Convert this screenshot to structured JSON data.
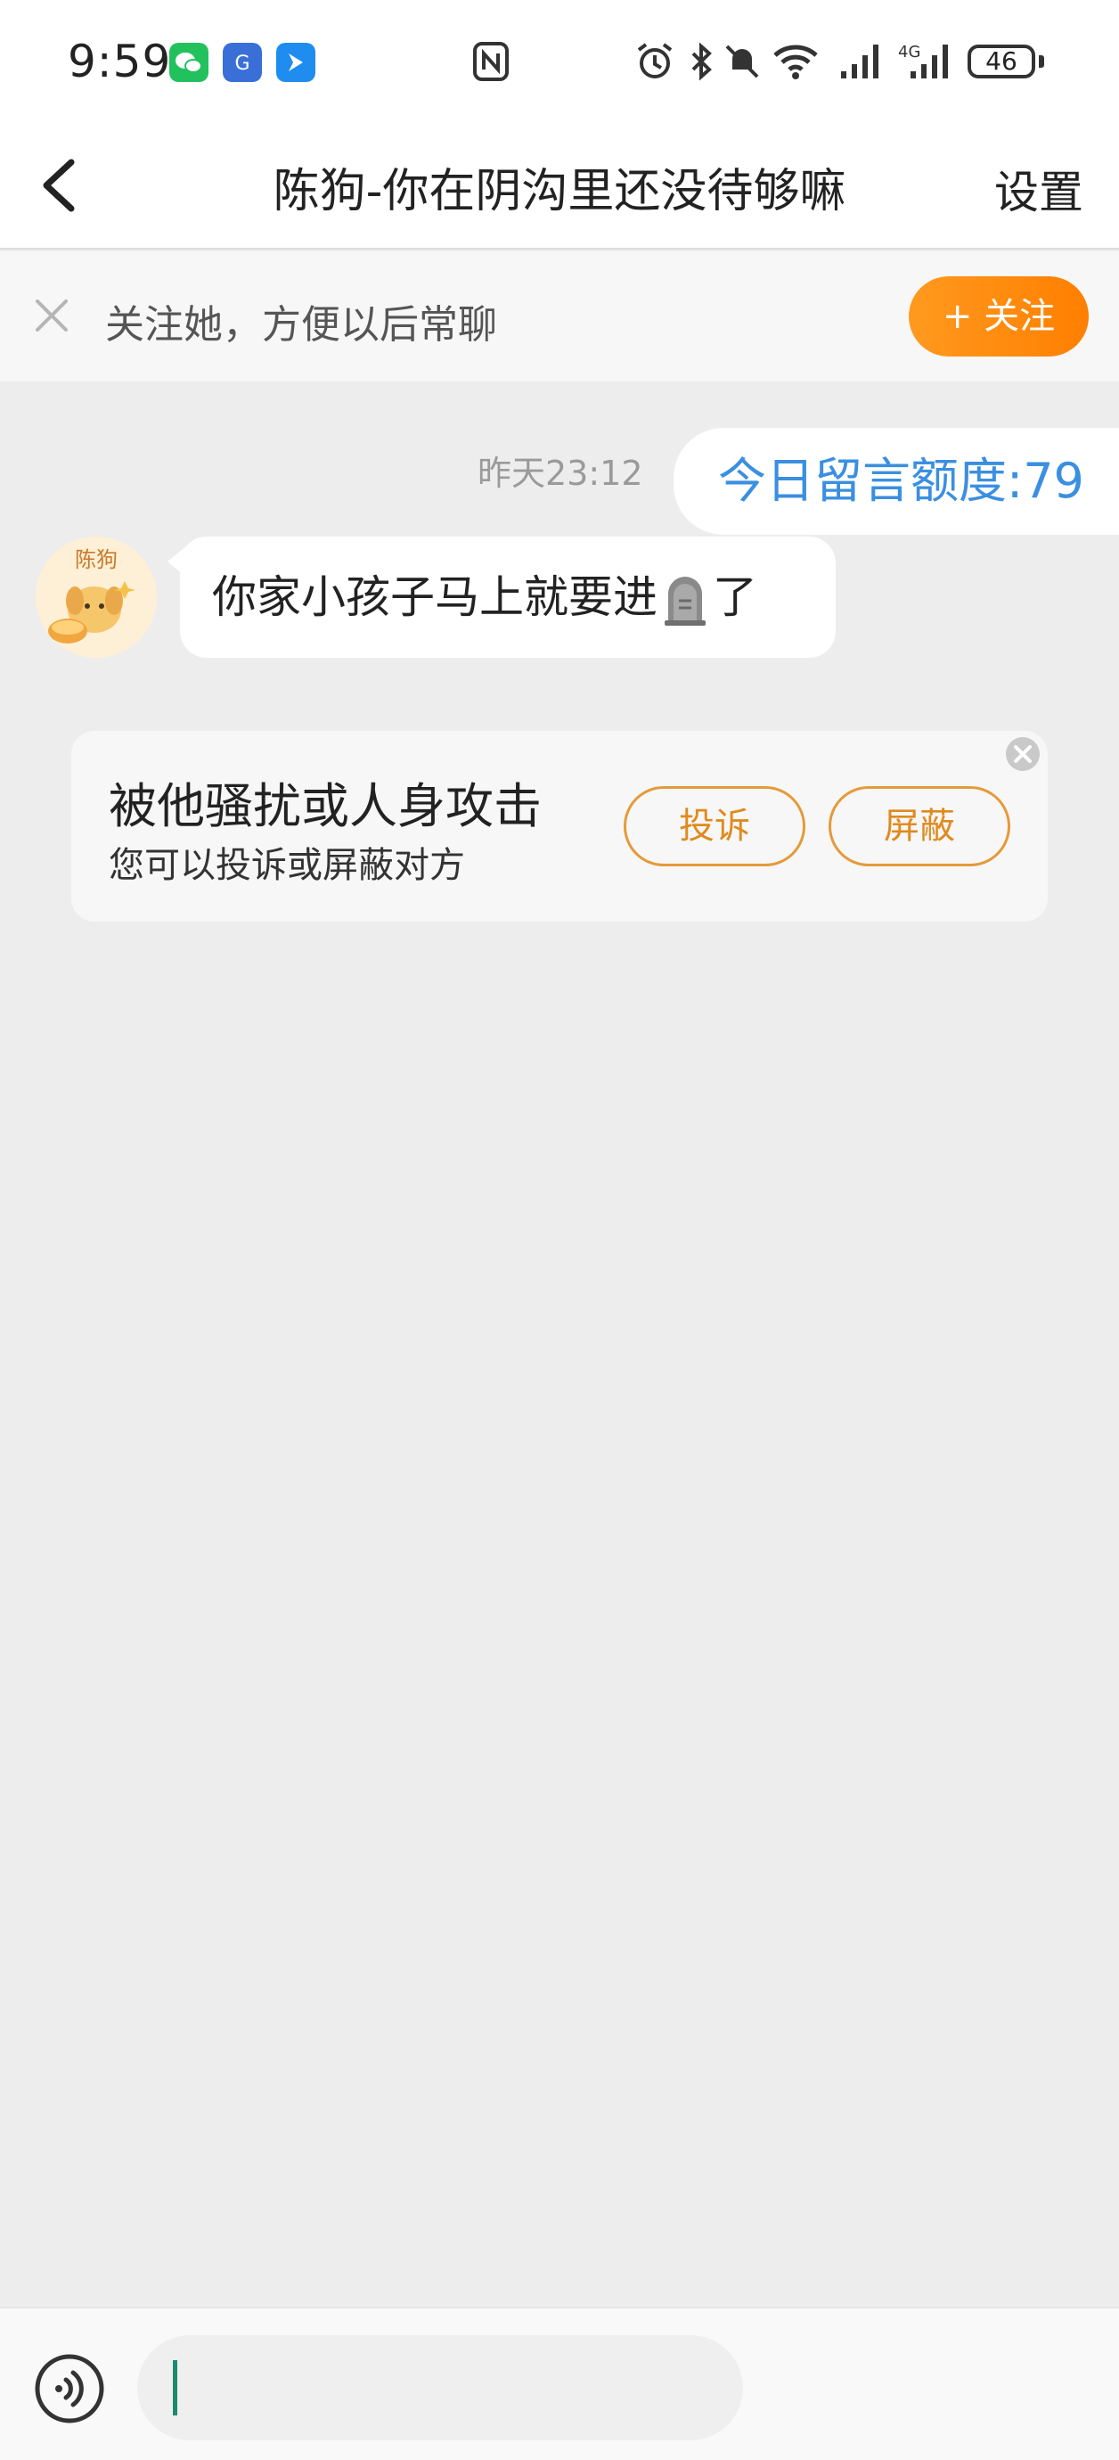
{
  "status_bar": {
    "time": "9:59",
    "network": "4G",
    "battery": "46",
    "icons": [
      "wechat-icon",
      "app-icon",
      "messenger-icon",
      "nfc-icon",
      "alarm-icon",
      "bluetooth-icon",
      "mute-icon",
      "wifi-icon",
      "signal-icon",
      "signal-4g-icon"
    ]
  },
  "header": {
    "back_icon": "chevron-left-icon",
    "title": "陈狗-你在阴沟里还没待够嘛",
    "settings_label": "设置"
  },
  "follow_bar": {
    "text": "关注她，方便以后常聊",
    "button_label": "+ 关注",
    "accent": "#ff8a0f"
  },
  "chat": {
    "timestamp": "昨天23:12",
    "right_bubble_text": "今日留言额度:79",
    "left_bubble_before": "你家小孩子马上就要进",
    "left_bubble_after": "了",
    "emoji": "headstone-icon",
    "avatar_label": "陈狗"
  },
  "harassment_card": {
    "title": "被他骚扰或人身攻击",
    "subtitle": "您可以投诉或屏蔽对方",
    "report_label": "投诉",
    "block_label": "屏蔽"
  },
  "input_bar": {
    "placeholder": "",
    "voice_icon": "voice-icon"
  },
  "colors": {
    "link_blue": "#3b8fe0",
    "orange": "#e08a1e",
    "background": "#ededed"
  }
}
